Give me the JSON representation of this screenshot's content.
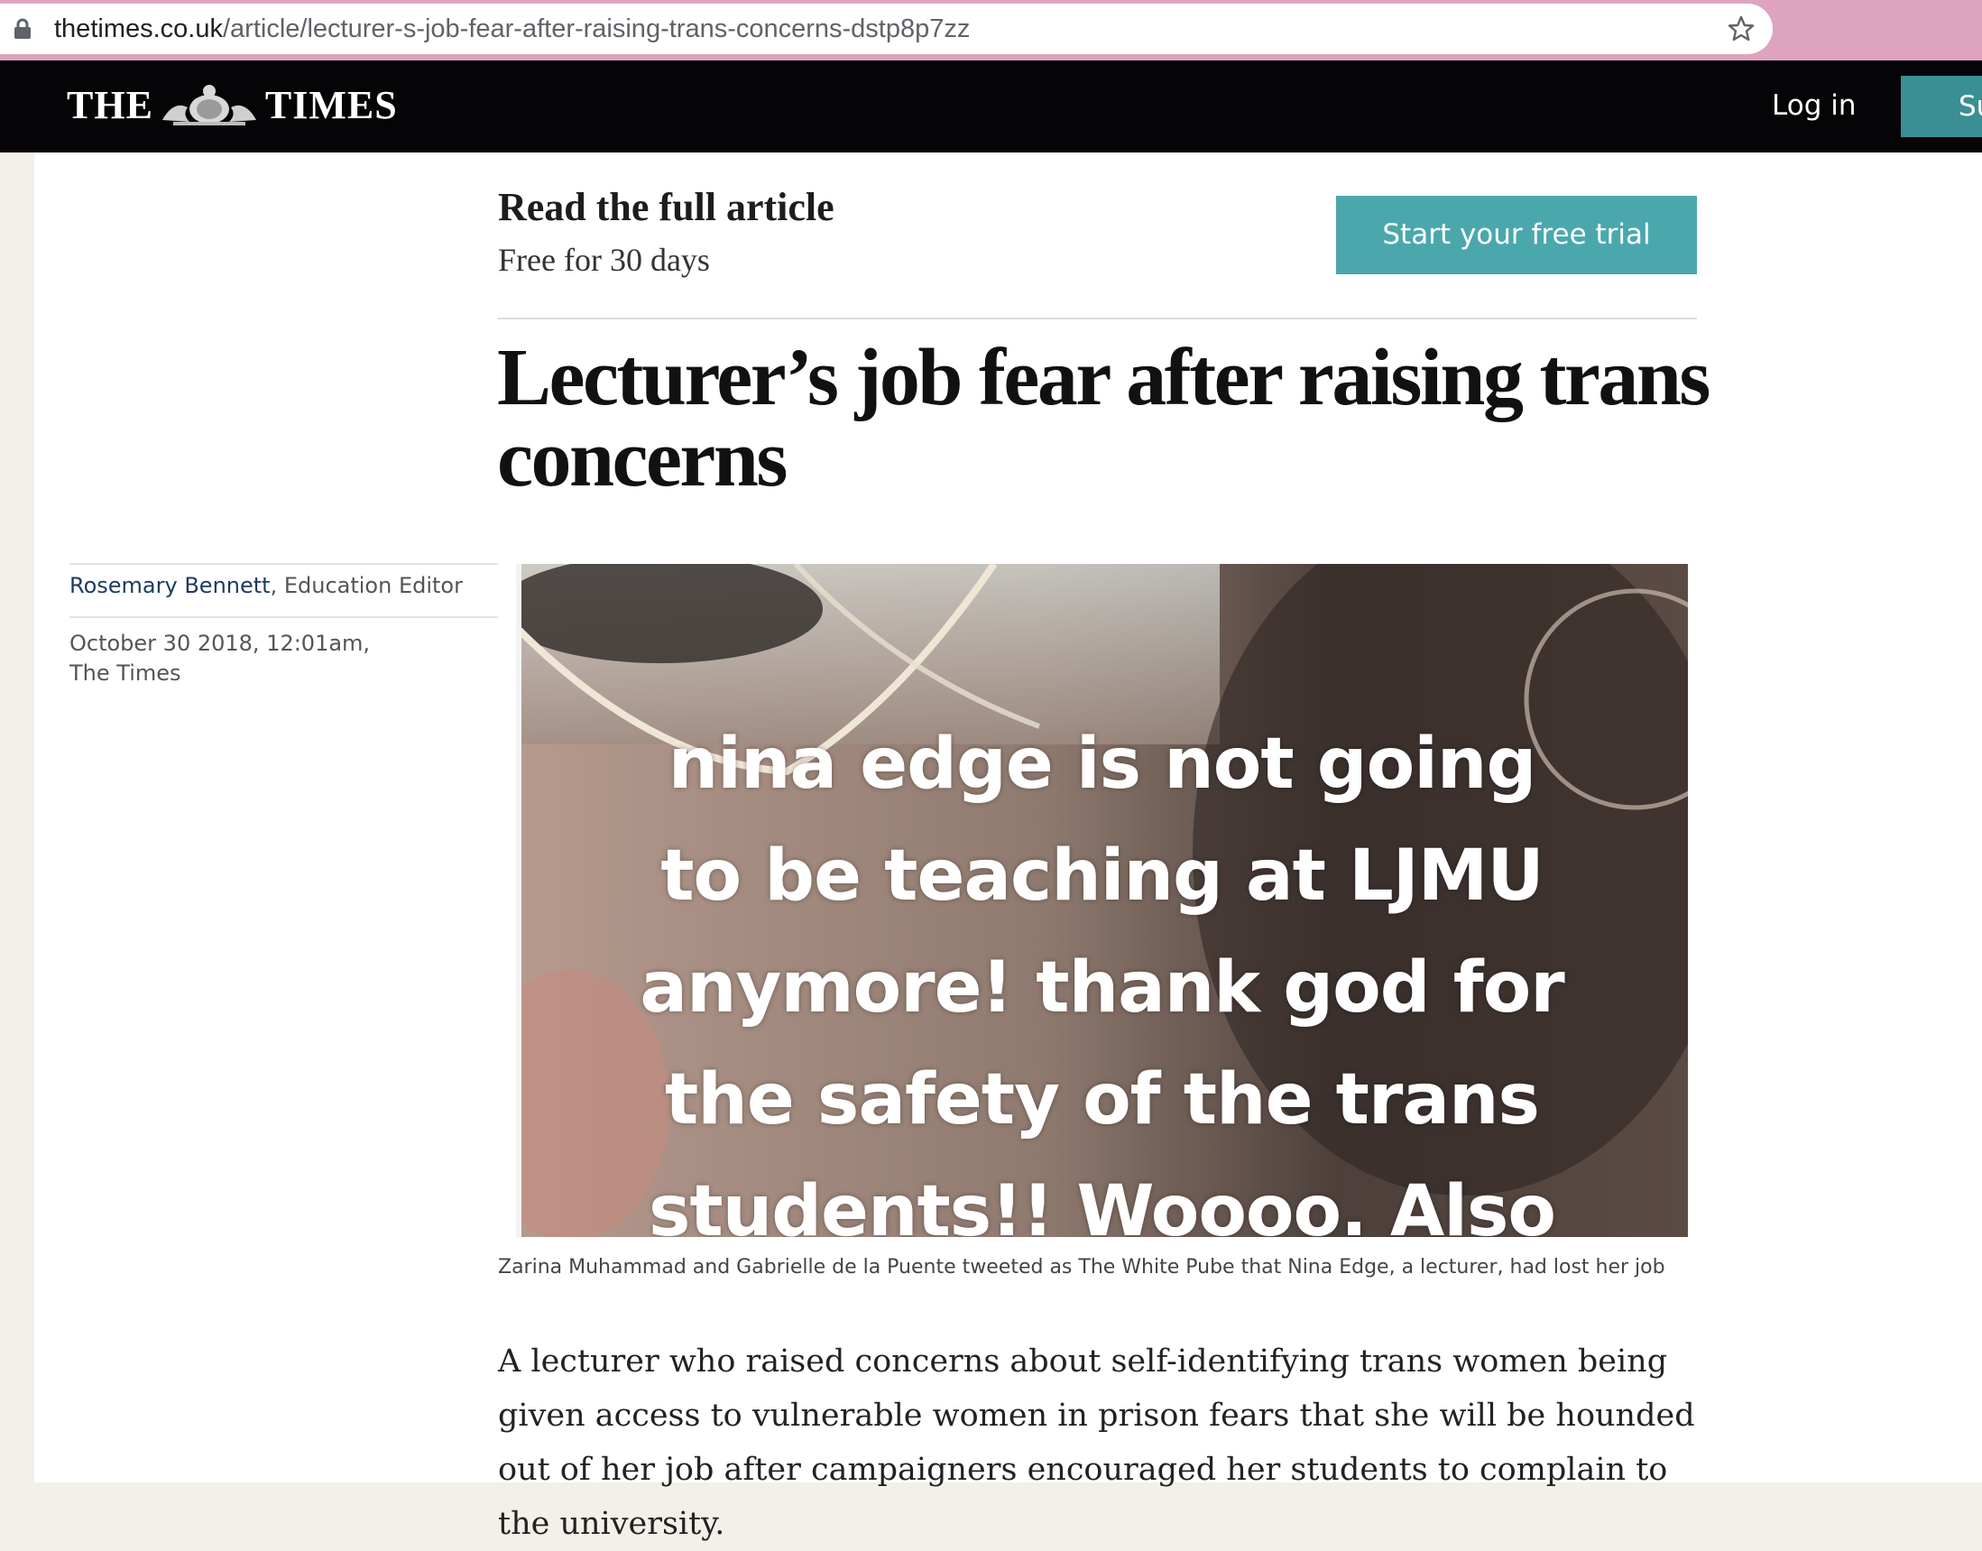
{
  "browser": {
    "url_host": "thetimes.co.uk",
    "url_path": "/article/lecturer-s-job-fear-after-raising-trans-concerns-dstp8p7zz",
    "icons": [
      "lock-icon",
      "star-icon"
    ]
  },
  "masthead": {
    "logo_left": "THE",
    "logo_right": "TIMES",
    "login_label": "Log in",
    "subscribe_label": "Su"
  },
  "promo": {
    "title": "Read the full article",
    "subtitle": "Free for 30 days",
    "cta_label": "Start your free trial"
  },
  "article": {
    "headline": "Lecturer’s job fear after raising trans concerns",
    "author": "Rosemary Bennett",
    "author_role": ", Education Editor",
    "date": "October 30 2018, 12:01am,\nThe Times",
    "image_text": "nina edge is not going\nto be teaching at LJMU\nanymore! thank god for\nthe safety of the trans\nstudents!! Woooo. Also",
    "caption": "Zarina Muhammad and Gabrielle de la Puente tweeted as The White Pube that Nina Edge, a lecturer, had lost her job",
    "body": "A lecturer who raised concerns about self-identifying trans women being given access to vulnerable women in prison fears that she will be hounded out of her job after campaigners encouraged her students to complain to the university."
  },
  "colors": {
    "browser_frame": "#dea3bf",
    "masthead": "#050508",
    "accent_teal": "#4aa8ad",
    "subscribe_teal": "#3a8f94"
  }
}
